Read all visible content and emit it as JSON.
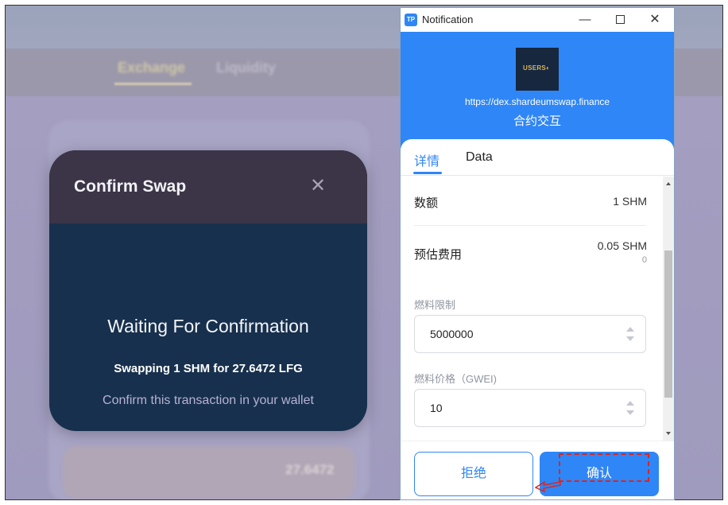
{
  "background": {
    "tabs": [
      "Exchange",
      "Liquidity"
    ],
    "amount": "27.6472"
  },
  "modal": {
    "title": "Confirm Swap",
    "close_glyph": "✕",
    "heading": "Waiting For Confirmation",
    "detail": "Swapping 1 SHM for 27.6472 LFG",
    "hint": "Confirm this transaction in your wallet"
  },
  "notification": {
    "window_title": "Notification",
    "app_icon": "TP",
    "dapp_logo_text": "USERS◐",
    "dapp_url": "https://dex.shardeumswap.finance",
    "action": "合约交互",
    "tabs": [
      "详情",
      "Data"
    ],
    "amount_label": "数额",
    "amount_value": "1 SHM",
    "fee_label": "预估费用",
    "fee_value": "0.05 SHM",
    "fee_sub": "0",
    "gas_limit_label": "燃料限制",
    "gas_limit_value": "5000000",
    "gas_price_label": "燃料价格（GWEI)",
    "gas_price_value": "10",
    "reject_label": "拒绝",
    "confirm_label": "确认"
  },
  "colors": {
    "accent": "#2f86f6",
    "modal_bg": "#17304d",
    "modal_header": "#3c3447",
    "highlight": "#e0241b"
  }
}
